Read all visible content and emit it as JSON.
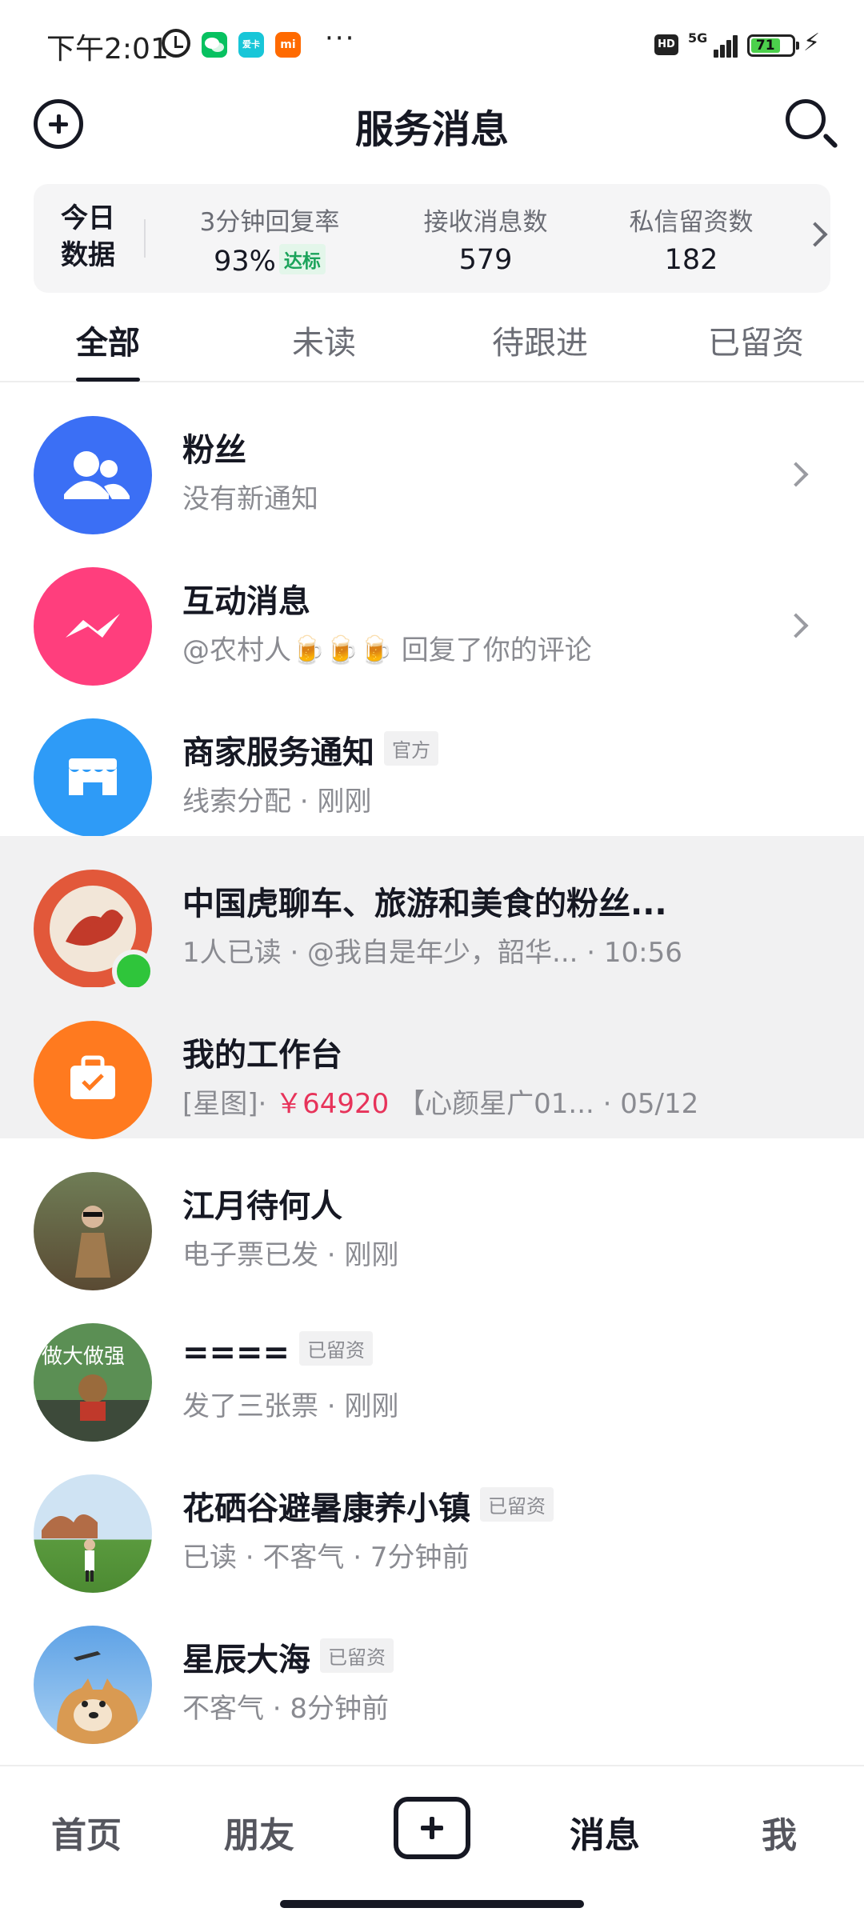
{
  "status_bar": {
    "time": "下午2:01",
    "apps": [
      "wechat-icon",
      "card-app-icon",
      "mi-icon"
    ],
    "app_labels": [
      "",
      "爱卡",
      "mi"
    ],
    "more": "···",
    "hd": "HD",
    "network": "5G",
    "battery": "71"
  },
  "header": {
    "title": "服务消息"
  },
  "stats": {
    "today_label": "今日数据",
    "items": [
      {
        "label": "3分钟回复率",
        "value": "93%",
        "badge": "达标"
      },
      {
        "label": "接收消息数",
        "value": "579"
      },
      {
        "label": "私信留资数",
        "value": "182"
      }
    ]
  },
  "tabs": [
    {
      "label": "全部",
      "active": true
    },
    {
      "label": "未读"
    },
    {
      "label": "待跟进"
    },
    {
      "label": "已留资"
    }
  ],
  "messages": [
    {
      "title": "粉丝",
      "subtitle": "没有新通知",
      "avatar": "fans-icon",
      "color": "#3b6ff5"
    },
    {
      "title": "互动消息",
      "subtitle": "@农村人🍺🍺🍺 回复了你的评论",
      "avatar": "interaction-icon",
      "color": "#ff3e7d"
    },
    {
      "title": "商家服务通知",
      "tag": "官方",
      "subtitle": "线索分配 · 刚刚",
      "avatar": "store-icon",
      "color": "#2e9bf7"
    },
    {
      "title": "中国虎聊车、旅游和美食的粉丝...",
      "subtitle": "1人已读 · @我自是年少，韶华... · 10:56",
      "avatar": "group-avatar"
    },
    {
      "title": "我的工作台",
      "subtitle_prefix": "[星图]· ",
      "subtitle_price": "￥64920",
      "subtitle_suffix": " 【心颜星广01... · 05/12",
      "avatar": "briefcase-icon",
      "color": "#ff7a1f"
    },
    {
      "title": "江月待何人",
      "subtitle": "电子票已发 · 刚刚",
      "avatar": "user-avatar"
    },
    {
      "title": "====",
      "tag": "已留资",
      "subtitle": "发了三张票 · 刚刚",
      "avatar": "user-avatar",
      "avatar_text": "做大做强"
    },
    {
      "title": "花硒谷避暑康养小镇",
      "tag": "已留资",
      "subtitle": "已读 · 不客气 · 7分钟前",
      "avatar": "user-avatar"
    },
    {
      "title": "星辰大海",
      "tag": "已留资",
      "subtitle": "不客气 · 8分钟前",
      "avatar": "user-avatar"
    }
  ],
  "bottom_nav": [
    {
      "label": "首页"
    },
    {
      "label": "朋友"
    },
    {
      "label": "",
      "icon": "plus-icon"
    },
    {
      "label": "消息",
      "active": true
    },
    {
      "label": "我"
    }
  ]
}
